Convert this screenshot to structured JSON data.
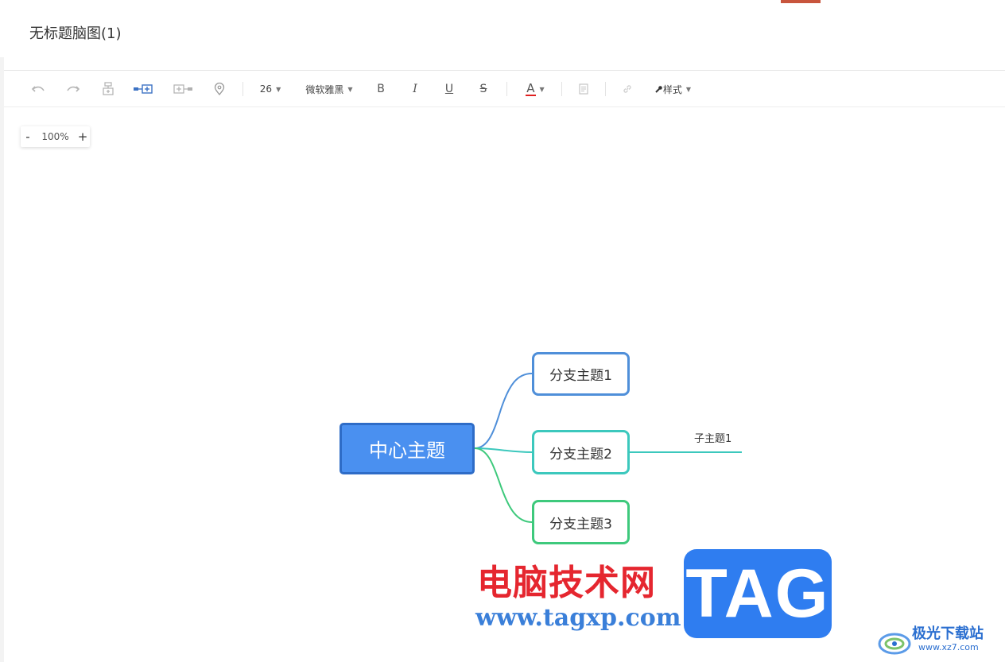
{
  "document": {
    "title": "无标题脑图(1)"
  },
  "toolbar": {
    "undo_icon": "undo-icon",
    "redo_icon": "redo-icon",
    "insert_child_icon": "insert-child-icon",
    "insert_sibling_icon": "insert-sibling-icon",
    "insert_parent_icon": "insert-parent-icon",
    "marker_icon": "location-pin-icon",
    "font_size": "26",
    "font_family": "微软雅黑",
    "bold_label": "B",
    "italic_label": "I",
    "underline_label": "U",
    "strike_label": "S",
    "font_color_label": "A",
    "font_color": "#e02020",
    "note_icon": "note-icon",
    "link_icon": "link-icon",
    "style_label": "样式",
    "style_icon": "brush-icon"
  },
  "zoom": {
    "minus": "-",
    "value": "100%",
    "plus": "+"
  },
  "mindmap": {
    "center": "中心主题",
    "branches": [
      "分支主题1",
      "分支主题2",
      "分支主题3"
    ],
    "subtopic": "子主题1",
    "colors": {
      "center_fill": "#4a90f0",
      "center_border": "#2e6cc7",
      "branch1": "#4f8fd9",
      "branch2": "#3cc8bd",
      "branch3": "#3ec97c"
    }
  },
  "watermark": {
    "cn_text": "电脑技术网",
    "url": "www.tagxp.com",
    "badge": "TAG",
    "site_name": "极光下载站",
    "site_url": "www.xz7.com"
  }
}
